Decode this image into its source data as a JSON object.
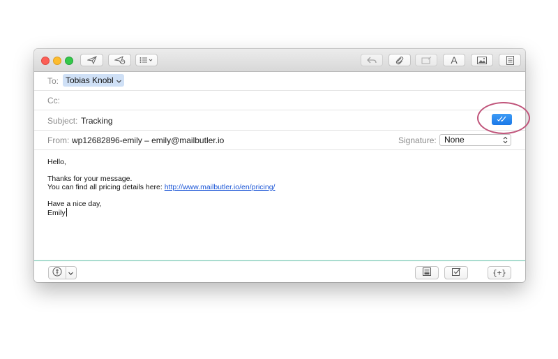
{
  "compose": {
    "to_label": "To:",
    "to_recipient": "Tobias Knobl",
    "cc_label": "Cc:",
    "cc_value": "",
    "subject_label": "Subject:",
    "subject_value": "Tracking",
    "from_label": "From:",
    "from_value": "wp12682896-emily – emily@mailbutler.io",
    "signature_label": "Signature:",
    "signature_value": "None"
  },
  "message": {
    "greeting": "Hello,",
    "line1": "Thanks for your message.",
    "line2_prefix": "You can find all pricing details here: ",
    "line2_link": "http://www.mailbutler.io/en/pricing/",
    "closing": "Have a nice day,",
    "name": "Emily"
  },
  "toolbar": {
    "icons": [
      "send-icon",
      "snooze-send-icon",
      "list-format-icon",
      "reply-icon",
      "attachment-icon",
      "template-icon",
      "font-icon",
      "photo-icon",
      "calendar-icon"
    ],
    "font_glyph": "A"
  },
  "footer": {
    "code_label": "{+}",
    "icons": [
      "mailbutler-icon",
      "notes-icon",
      "task-icon",
      "code-icon"
    ]
  },
  "colors": {
    "accent": "#1a78e8",
    "highlight": "#c0547a",
    "footer_line": "#a9dccf",
    "token": "#cfe0f6"
  }
}
